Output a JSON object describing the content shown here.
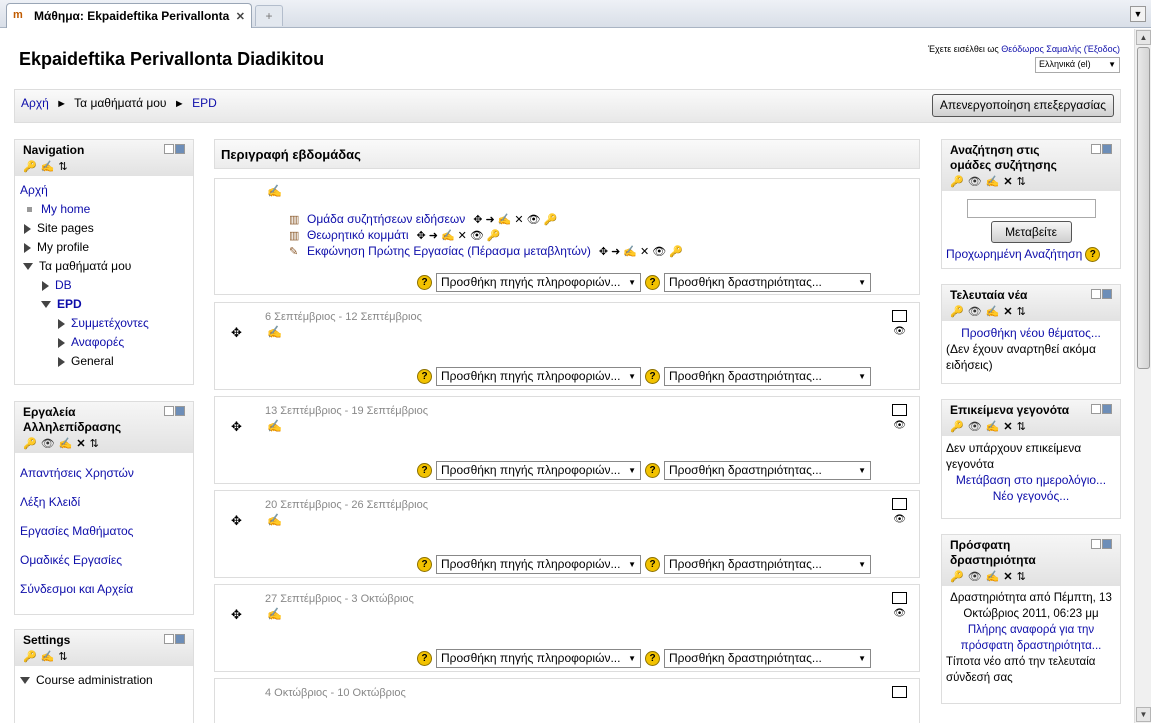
{
  "browser": {
    "tab_title": "Μάθημα: Ekpaideftika Perivallonta D...",
    "new_tab": "+"
  },
  "header": {
    "site_title": "Ekpaideftika Perivallonta Diadikitou",
    "login_prefix": "Έχετε εισέλθει ως ",
    "user_name": "Θεόδωρος Σαμαλής",
    "logout_label": "(Έξοδος)",
    "language": "Ελληνικά (el)"
  },
  "breadcrumb": {
    "home": "Αρχή",
    "my_courses": "Τα μαθήματά μου",
    "current": "EPD",
    "separator": "►"
  },
  "edit_button": "Απενεργοποίηση επεξεργασίας",
  "navigation": {
    "title": "Navigation",
    "home": "Αρχή",
    "my_home": "My home",
    "site_pages": "Site pages",
    "my_profile": "My profile",
    "my_courses": "Τα μαθήματά μου",
    "db": "DB",
    "epd": "EPD",
    "participants": "Συμμετέχοντες",
    "reports": "Αναφορές",
    "general": "General"
  },
  "interaction_tools": {
    "title": "Εργαλεία Αλληλεπίδρασης",
    "items": [
      "Απαντήσεις Χρηστών",
      "Λέξη Κλειδί",
      "Εργασίες Μαθήματος",
      "Ομαδικές Εργασίες",
      "Σύνδεσμοι και Αρχεία"
    ]
  },
  "settings": {
    "title": "Settings",
    "course_admin": "Course administration"
  },
  "main": {
    "week_title": "Περιγραφή εβδομάδας",
    "add_resource": "Προσθήκη πηγής πληροφοριών...",
    "add_activity": "Προσθήκη δραστηριότητας...",
    "activities": [
      "Ομάδα συζητήσεων ειδήσεων",
      "Θεωρητικό κομμάτι",
      "Εκφώνηση Πρώτης Εργασίας (Πέρασμα μεταβλητών)"
    ],
    "weeks": [
      "6 Σεπτέμβριος - 12 Σεπτέμβριος",
      "13 Σεπτέμβριος - 19 Σεπτέμβριος",
      "20 Σεπτέμβριος - 26 Σεπτέμβριος",
      "27 Σεπτέμβριος - 3 Οκτώβριος",
      "4 Οκτώβριος - 10 Οκτώβριος"
    ]
  },
  "forum_search": {
    "title": "Αναζήτηση στις ομάδες συζήτησης",
    "button": "Μεταβείτε",
    "advanced": "Προχωρημένη Αναζήτηση"
  },
  "latest_news": {
    "title": "Τελευταία νέα",
    "add_topic": "Προσθήκη νέου θέματος...",
    "none": "(Δεν έχουν αναρτηθεί ακόμα ειδήσεις)"
  },
  "upcoming_events": {
    "title": "Επικείμενα γεγονότα",
    "none": "Δεν υπάρχουν επικείμενα γεγονότα",
    "calendar_link": "Μετάβαση στο ημερολόγιο...",
    "new_event": "Νέο γεγονός..."
  },
  "recent_activity": {
    "title": "Πρόσφατη δραστηριότητα",
    "since": "Δραστηριότητα από Πέμπτη, 13 Οκτώβριος 2011, 06:23 μμ",
    "full_report": "Πλήρης αναφορά για την πρόσφατη δραστηριότητα...",
    "nothing": "Τίποτα νέο από την τελευταία σύνδεσή σας"
  }
}
